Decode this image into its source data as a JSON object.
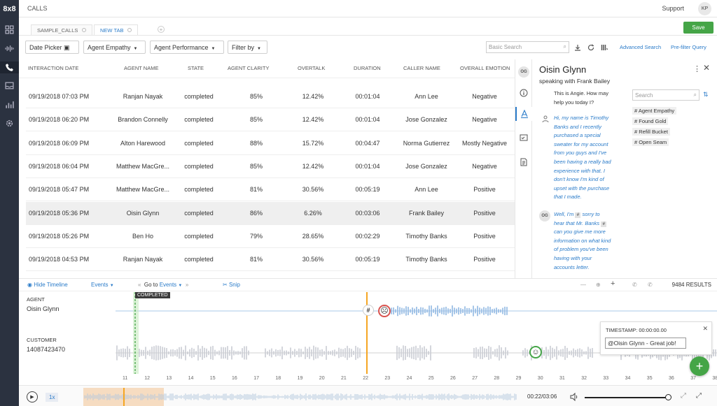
{
  "app": {
    "logo": "8x8",
    "title": "CALLS",
    "support": "Support",
    "user_initials": "KP"
  },
  "tabs": [
    {
      "label": "SAMPLE_CALLS"
    },
    {
      "label": "NEW TAB"
    }
  ],
  "save_label": "Save",
  "filters": {
    "date_picker": "Date Picker",
    "agent_empathy": "Agent Empathy",
    "agent_performance": "Agent Performance",
    "filter_by": "Filter by",
    "search_placeholder": "Basic Search",
    "advanced_search": "Advanced Search",
    "prefilter_query": "Pre-filter Query"
  },
  "table": {
    "headers": [
      "INTERACTION DATE",
      "AGENT NAME",
      "STATE",
      "AGENT CLARITY",
      "OVERTALK",
      "DURATION",
      "CALLER NAME",
      "OVERALL EMOTION"
    ],
    "rows": [
      [
        "09/19/2018 07:03 PM",
        "Ranjan Nayak",
        "completed",
        "85%",
        "12.42%",
        "00:01:04",
        "Ann Lee",
        "Negative"
      ],
      [
        "09/19/2018 06:20 PM",
        "Brandon Connelly",
        "completed",
        "85%",
        "12.42%",
        "00:01:04",
        "Jose Gonzalez",
        "Negative"
      ],
      [
        "09/19/2018 06:09 PM",
        "Alton Harewood",
        "completed",
        "88%",
        "15.72%",
        "00:04:47",
        "Norma Gutierrez",
        "Mostly Negative"
      ],
      [
        "09/19/2018 06:04 PM",
        "Matthew MacGre...",
        "completed",
        "85%",
        "12.42%",
        "00:01:04",
        "Jose Gonzalez",
        "Negative"
      ],
      [
        "09/19/2018 05:47 PM",
        "Matthew MacGre...",
        "completed",
        "81%",
        "30.56%",
        "00:05:19",
        "Ann Lee",
        "Positive"
      ],
      [
        "09/19/2018 05:36 PM",
        "Oisin Glynn",
        "completed",
        "86%",
        "6.26%",
        "00:03:06",
        "Frank Bailey",
        "Positive"
      ],
      [
        "09/19/2018 05:26 PM",
        "Ben Ho",
        "completed",
        "79%",
        "28.65%",
        "00:02:29",
        "Timothy Banks",
        "Positive"
      ],
      [
        "09/19/2018 04:53 PM",
        "Ranjan Nayak",
        "completed",
        "81%",
        "30.56%",
        "00:05:19",
        "Timothy Banks",
        "Positive"
      ]
    ]
  },
  "panel": {
    "og": "OG",
    "name": "Oisin Glynn",
    "subtitle": "speaking with Frank Bailey",
    "transcript": {
      "agent1": "This is Angie. How may\nhelp you today I?",
      "customer": "Hi, my name is Timothy\nBanks and I recently\npurchased a special\nsweater for my account\nfrom you guys and I've\nbeen having a really bad\nexperience with that. I\ndon't know I'm kind of\nupset with the purchase\nthat I made.",
      "agent2_a": "Well, I'm ",
      "agent2_b": " sorry to",
      "agent2_c": "hear that Mr. Banks ",
      "agent2_rest": "can you give me more\ninformation on what kind\nof problem you've been\nhaving with your\naccounts letter."
    },
    "search_placeholder": "Search",
    "tags": [
      "# Agent Empathy",
      "# Found Gold",
      "# Refill Bucket",
      "# Open Seam"
    ]
  },
  "timeline": {
    "hide": "Hide Timeline",
    "events": "Events",
    "goto": "Go to",
    "goto_events": "Events",
    "snip": "Snip",
    "results": "9484 RESULTS",
    "agent_label": "AGENT",
    "agent_name": "Oisin Glynn",
    "customer_label": "CUSTOMER",
    "customer_number": "14087423470",
    "marker": "COMPLETED",
    "popup_timestamp": "TIMESTAMP: 00:00:00.00",
    "popup_value": "@Oisin Glynn - Great job!",
    "ticks": [
      "11",
      "12",
      "13",
      "14",
      "15",
      "16",
      "17",
      "18",
      "19",
      "20",
      "21",
      "22",
      "23",
      "24",
      "25",
      "26",
      "27",
      "28",
      "29",
      "30",
      "31",
      "32",
      "33",
      "34",
      "35",
      "36",
      "37",
      "38"
    ]
  },
  "player": {
    "speed": "1x",
    "time": "00:22/03:06"
  },
  "colors": {
    "accent": "#2a7bc9",
    "save": "#45a547",
    "nav": "#2b3240",
    "playhead": "#f5a623"
  }
}
